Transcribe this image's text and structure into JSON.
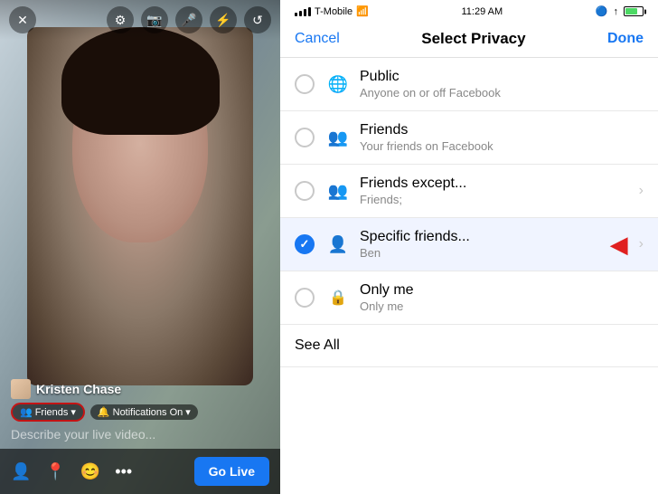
{
  "left": {
    "user_name": "Kristen Chase",
    "badges": {
      "friends_label": "Friends",
      "notifications_label": "Notifications On"
    },
    "describe_placeholder": "Describe your live video...",
    "go_live_label": "Go Live",
    "toolbar_icons": [
      "✕",
      "🔧",
      "🎥",
      "🎤",
      "⚡",
      "🔄"
    ]
  },
  "right": {
    "status_bar": {
      "carrier": "T-Mobile",
      "time": "11:29 AM",
      "wifi": true
    },
    "nav": {
      "cancel": "Cancel",
      "title": "Select Privacy",
      "done": "Done"
    },
    "privacy_options": [
      {
        "id": "public",
        "title": "Public",
        "subtitle": "Anyone on or off Facebook",
        "icon": "globe",
        "selected": false,
        "has_chevron": false
      },
      {
        "id": "friends",
        "title": "Friends",
        "subtitle": "Your friends on Facebook",
        "icon": "friends",
        "selected": false,
        "has_chevron": false
      },
      {
        "id": "friends-except",
        "title": "Friends except...",
        "subtitle": "Friends;",
        "icon": "friends",
        "selected": false,
        "has_chevron": true
      },
      {
        "id": "specific-friends",
        "title": "Specific friends...",
        "subtitle": "Ben",
        "icon": "friends",
        "selected": true,
        "has_chevron": true,
        "has_arrow": true
      },
      {
        "id": "only-me",
        "title": "Only me",
        "subtitle": "Only me",
        "icon": "lock",
        "selected": false,
        "has_chevron": false
      }
    ],
    "see_all_label": "See All"
  }
}
